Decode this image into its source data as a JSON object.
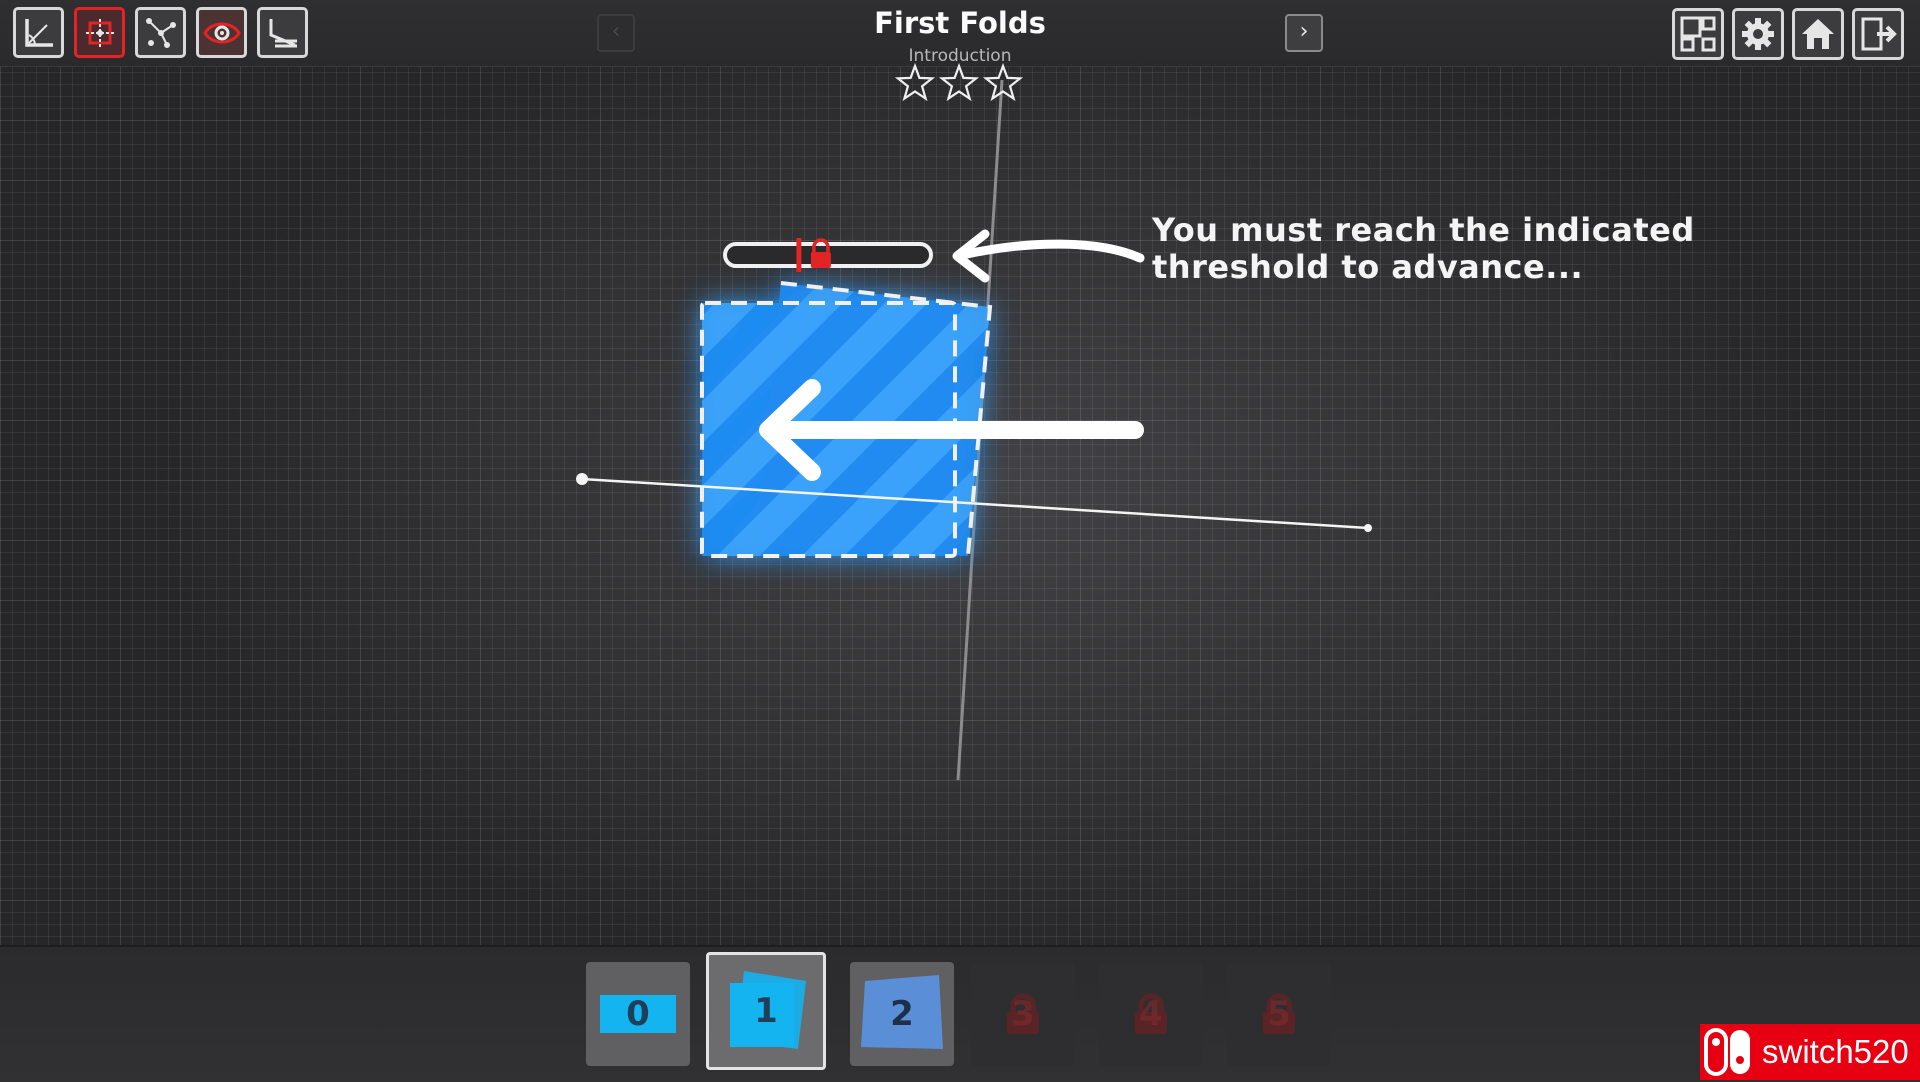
{
  "toolbar": {
    "tools": [
      {
        "name": "reset-view-icon",
        "active": false
      },
      {
        "name": "fold-tool-icon",
        "active": true
      },
      {
        "name": "node-tool-icon",
        "active": false
      },
      {
        "name": "eye-icon",
        "active": false
      },
      {
        "name": "unfold-tool-icon",
        "active": false
      }
    ]
  },
  "header": {
    "title": "First Folds",
    "subtitle": "Introduction",
    "stars_total": 3,
    "stars_earned": 0,
    "prev_label": "‹",
    "next_label": "›"
  },
  "menu": {
    "buttons": [
      "level-select-icon",
      "settings-icon",
      "home-icon",
      "exit-icon"
    ]
  },
  "progress": {
    "fill_fraction": 0.0,
    "threshold_fraction": 0.35,
    "threshold_locked": true
  },
  "hint": {
    "line1": "You must reach the indicated",
    "line2": "threshold to advance..."
  },
  "steps": [
    {
      "label": "0",
      "state": "done"
    },
    {
      "label": "1",
      "state": "current"
    },
    {
      "label": "2",
      "state": "done"
    },
    {
      "label": "3",
      "state": "locked"
    },
    {
      "label": "4",
      "state": "locked"
    },
    {
      "label": "5",
      "state": "locked"
    }
  ],
  "watermark": {
    "text": "switch520"
  },
  "colors": {
    "paper_blue": "#1e8ff5",
    "accent_red": "#e32424",
    "step_cyan": "#14b4f0",
    "lock_red": "#7a2a2c"
  }
}
